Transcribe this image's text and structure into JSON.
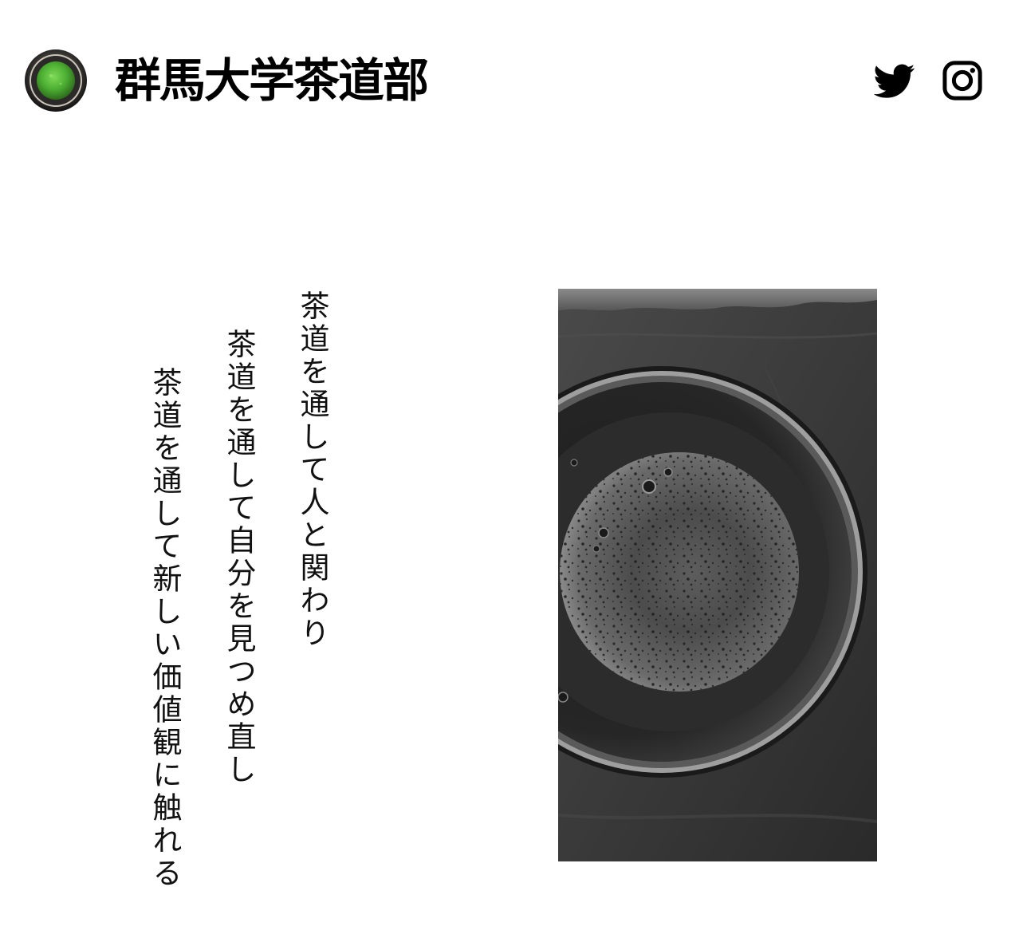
{
  "header": {
    "site_title": "群馬大学茶道部",
    "logo_icon": "matcha-bowl-icon",
    "social": [
      {
        "name": "twitter-icon"
      },
      {
        "name": "instagram-icon"
      }
    ]
  },
  "poem": {
    "lines": [
      "茶道を通して人と関わり",
      "茶道を通して自分を見つめ直し",
      "茶道を通して新しい価値観に触れる"
    ]
  },
  "photo": {
    "subject": "matcha-bowl-photo",
    "style": "grayscale"
  },
  "colors": {
    "background": "#ffffff",
    "text": "#000000",
    "matcha_green": "#4caf32"
  }
}
